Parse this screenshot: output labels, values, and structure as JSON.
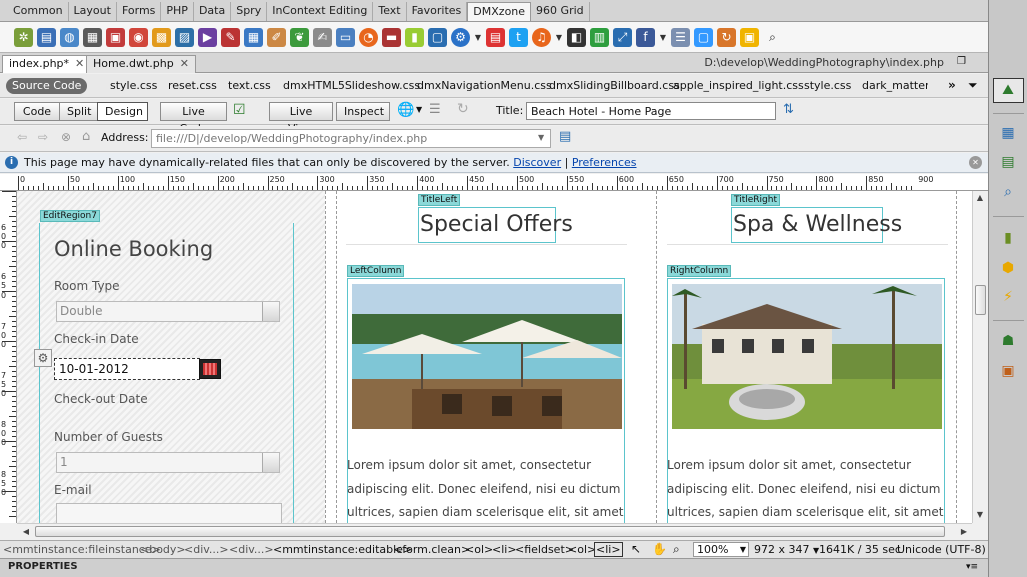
{
  "insert_tabs": [
    "Common",
    "Layout",
    "Forms",
    "PHP",
    "Data",
    "Spry",
    "InContext Editing",
    "Text",
    "Favorites",
    "DMXzone",
    "960 Grid"
  ],
  "active_insert_tab": "DMXzone",
  "doc_tabs": [
    {
      "label": "index.php*"
    },
    {
      "label": "Home.dwt.php"
    }
  ],
  "doc_path": "D:\\develop\\WeddingPhotography\\index.php",
  "source_code_label": "Source Code",
  "related_files": [
    "style.css",
    "reset.css",
    "text.css",
    "dmxHTML5Slideshow.css",
    "dmxNavigationMenu.css",
    "dmxSlidingBillboard.css",
    "apple_inspired_light.css",
    "style.css",
    "dark_matter.c"
  ],
  "view_buttons": {
    "code": "Code",
    "split": "Split",
    "design": "Design",
    "live_code": "Live Code",
    "live_view": "Live View",
    "inspect": "Inspect"
  },
  "title_label": "Title:",
  "page_title": "Beach Hotel - Home Page",
  "address_label": "Address:",
  "address_value": "file:///D|/develop/WeddingPhotography/index.php",
  "info_bar": {
    "message": "This page may have dynamically-related files that can only be discovered by the server.",
    "discover": "Discover",
    "separator": "|",
    "preferences": "Preferences"
  },
  "ruler_ticks": [
    "0",
    "50",
    "100",
    "150",
    "200",
    "250",
    "300",
    "350",
    "400",
    "450",
    "500",
    "550",
    "600",
    "650",
    "700",
    "750",
    "800",
    "850",
    "900"
  ],
  "vruler_labels": [
    "6",
    "0",
    "0",
    "6",
    "5",
    "0",
    "7",
    "0",
    "0",
    "7",
    "5",
    "0",
    "8",
    "0",
    "0",
    "8",
    "5",
    "0"
  ],
  "left_region": {
    "tag": "EditRegion7",
    "heading": "Online Booking"
  },
  "form": {
    "room_type_label": "Room Type",
    "room_type_value": "Double",
    "checkin_label": "Check-in Date",
    "checkin_value": "10-01-2012",
    "checkout_label": "Check-out Date",
    "guests_label": "Number of Guests",
    "guests_value": "1",
    "email_label": "E-mail"
  },
  "title_left": {
    "tag": "TitleLeft",
    "text": "Special Offers"
  },
  "title_right": {
    "tag": "TitleRight",
    "text": "Spa & Wellness"
  },
  "left_column": {
    "tag": "LeftColumn",
    "lines": [
      "Lorem ipsum dolor sit amet, consectetur",
      "adipiscing elit. Donec eleifend, nisi eu dictum",
      "ultrices, sapien diam scelerisque elit, sit amet"
    ]
  },
  "right_column": {
    "tag": "RightColumn",
    "lines": [
      "Lorem ipsum dolor sit amet, consectetur",
      "adipiscing elit. Donec eleifend, nisi eu dictum",
      "ultrices, sapien diam scelerisque elit, sit amet"
    ]
  },
  "status_crumbs": [
    "<mmtinstance:fileinstance>",
    "<body>",
    "<div...>",
    "<div...>",
    "<mmtinstance:editable>",
    "<form.clean>",
    "<ol>",
    "<li>",
    "<fieldset>",
    "<ol>",
    "<li>"
  ],
  "zoom": "100%",
  "window_size": "972 x 347",
  "download_stats": "1641K / 35 sec",
  "encoding": "Unicode (UTF-8)",
  "properties_label": "PROPERTIES",
  "colors": {
    "region_border": "#5bc4cc",
    "region_tag": "#8ad8d8",
    "link": "#0645ad"
  }
}
